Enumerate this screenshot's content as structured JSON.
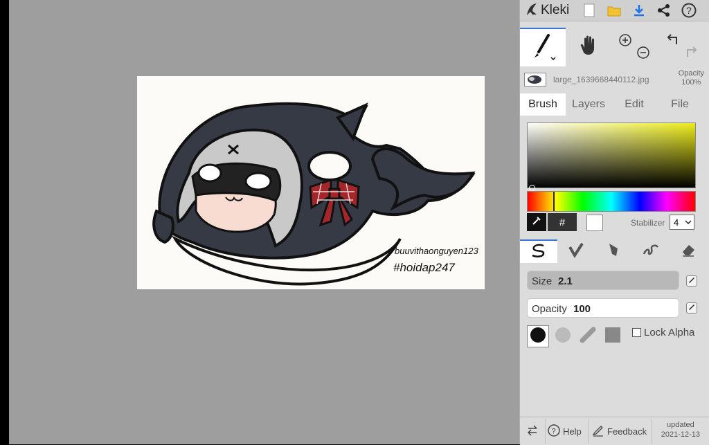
{
  "app": {
    "title": "Kleki"
  },
  "file": {
    "name": "large_1639668440112.jpg",
    "opacity_label": "Opacity",
    "opacity_value": "100%"
  },
  "tabs": [
    {
      "label": "Brush"
    },
    {
      "label": "Layers"
    },
    {
      "label": "Edit"
    },
    {
      "label": "File"
    }
  ],
  "color": {
    "hex_symbol": "#",
    "current": "#ffffff",
    "accent": "#3a76d8"
  },
  "stabilizer": {
    "label": "Stabilizer",
    "value": "4"
  },
  "brush": {
    "size_label": "Size",
    "size_value": "2.1",
    "size_fraction": 0.03,
    "opacity_label": "Opacity",
    "opacity_value": "100",
    "opacity_fraction": 1.0
  },
  "lock_alpha": {
    "label": "Lock Alpha",
    "checked": false
  },
  "footer": {
    "help": "Help",
    "feedback": "Feedback",
    "updated_label": "updated",
    "updated_date": "2021-12-13"
  },
  "artwork": {
    "line1": "buuvithaonguyen123",
    "line2": "#hoidap247"
  },
  "icons": [
    "kleki-logo-icon",
    "new-file-icon",
    "open-folder-icon",
    "download-icon",
    "share-icon",
    "help-circle-icon",
    "brush-tool-icon",
    "hand-tool-icon",
    "zoom-in-icon",
    "zoom-out-icon",
    "undo-icon",
    "redo-icon",
    "eyedropper-icon",
    "pen-pressure-icon",
    "swap-icon",
    "feedback-icon"
  ]
}
